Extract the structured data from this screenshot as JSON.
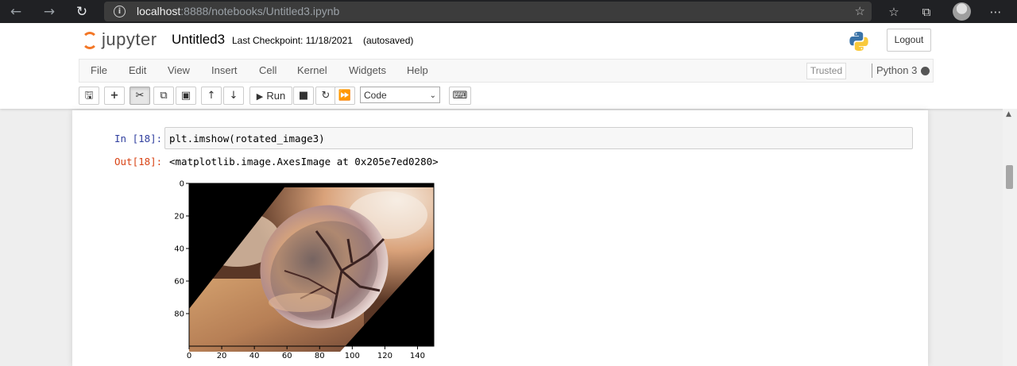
{
  "browser": {
    "url_host": "localhost",
    "url_rest": ":8888/notebooks/Untitled3.ipynb"
  },
  "header": {
    "logo_text": "jupyter",
    "notebook_title": "Untitled3",
    "checkpoint": "Last Checkpoint: 11/18/2021",
    "autosaved": "(autosaved)",
    "logout_label": "Logout"
  },
  "menu": {
    "items": [
      "File",
      "Edit",
      "View",
      "Insert",
      "Cell",
      "Kernel",
      "Widgets",
      "Help"
    ],
    "trusted": "Trusted",
    "kernel": "Python 3"
  },
  "toolbar": {
    "run_label": "Run",
    "cell_type": "Code"
  },
  "cell": {
    "in_prompt": "In [18]:",
    "code": "plt.imshow(rotated_image3)",
    "out_prompt": "Out[18]:",
    "output_text": "<matplotlib.image.AxesImage at 0x205e7ed0280>"
  },
  "chart_data": {
    "type": "image",
    "x_ticks": [
      "0",
      "20",
      "40",
      "60",
      "80",
      "100",
      "120",
      "140"
    ],
    "y_ticks": [
      "0",
      "20",
      "40",
      "60",
      "80"
    ],
    "xlim": [
      0,
      150
    ],
    "ylim": [
      100,
      0
    ]
  },
  "colors": {
    "jupyter_orange": "#f37726",
    "in_prompt": "#303f9f",
    "out_prompt": "#d84315"
  }
}
